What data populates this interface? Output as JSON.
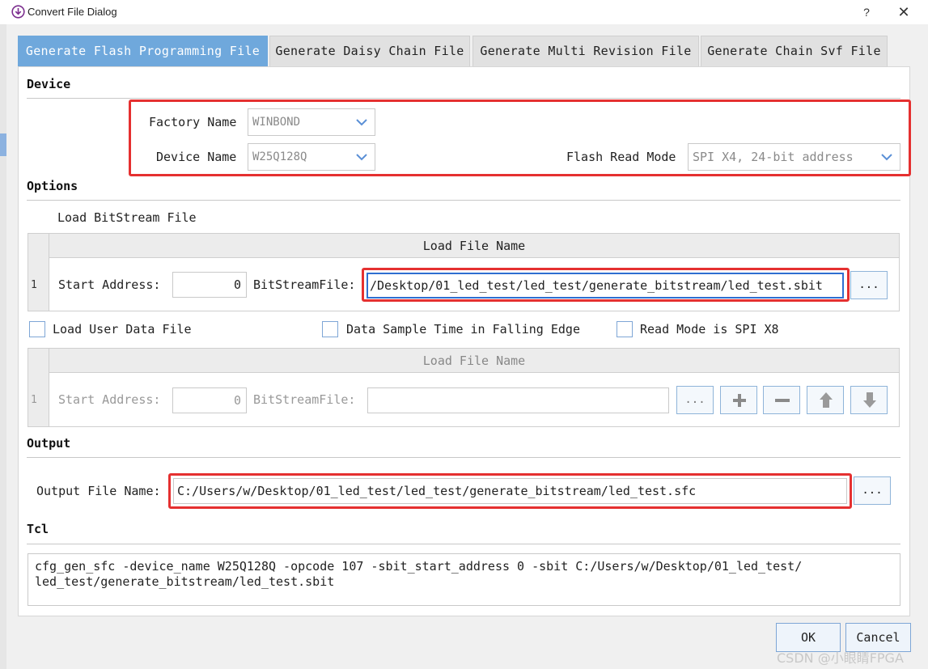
{
  "window": {
    "title": "Convert File Dialog",
    "help_glyph": "?",
    "close_glyph": "✕"
  },
  "tabs": [
    {
      "label": "Generate Flash Programming File",
      "active": true
    },
    {
      "label": "Generate Daisy Chain File",
      "active": false
    },
    {
      "label": "Generate Multi Revision File",
      "active": false
    },
    {
      "label": "Generate Chain Svf File",
      "active": false
    }
  ],
  "device": {
    "section_title": "Device",
    "factory_label": "Factory Name",
    "factory_value": "WINBOND",
    "device_label": "Device Name",
    "device_value": "W25Q128Q",
    "read_mode_label": "Flash Read Mode",
    "read_mode_value": "SPI X4, 24-bit address"
  },
  "options": {
    "section_title": "Options",
    "load_bitstream_label": "Load BitStream File",
    "table1": {
      "header": "Load File Name",
      "row_num": "1",
      "start_label": "Start Address:",
      "start_value": "0",
      "bitstream_label": "BitStreamFile:",
      "bitstream_value": "/Desktop/01_led_test/led_test/generate_bitstream/led_test.sbit",
      "browse_label": "..."
    },
    "check_user_data": "Load User Data File",
    "check_falling_edge": "Data Sample Time in Falling Edge",
    "check_spi_x8": "Read Mode is SPI X8",
    "table2": {
      "header": "Load File Name",
      "row_num": "1",
      "start_label": "Start Address:",
      "start_value": "0",
      "bitstream_label": "BitStreamFile:",
      "bitstream_value": "",
      "browse_label": "..."
    }
  },
  "output": {
    "section_title": "Output",
    "file_label": "Output File Name:",
    "file_value": "C:/Users/w/Desktop/01_led_test/led_test/generate_bitstream/led_test.sfc",
    "browse_label": "..."
  },
  "tcl": {
    "section_title": "Tcl",
    "line1": "cfg_gen_sfc -device_name W25Q128Q -opcode 107 -sbit_start_address 0 -sbit C:/Users/w/Desktop/01_led_test/",
    "line2": "led_test/generate_bitstream/led_test.sbit"
  },
  "buttons": {
    "ok": "OK",
    "cancel": "Cancel"
  },
  "watermark": "CSDN @小眼睛FPGA",
  "colors": {
    "active_tab": "#6fa8dc",
    "highlight_frame": "#e53030",
    "focus_border": "#2f6fd1"
  }
}
